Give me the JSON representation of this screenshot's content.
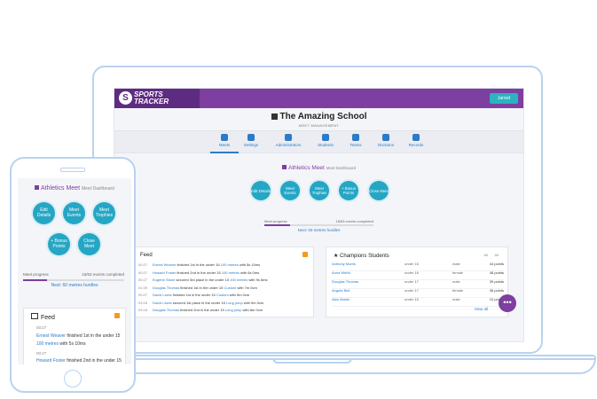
{
  "app": {
    "logo_top": "SPORTS",
    "logo_bottom": "TRACKER",
    "account_button": "Jarrod"
  },
  "school": {
    "title": "The Amazing School",
    "subtitle": "MEET MANAGEMENT"
  },
  "nav": [
    {
      "label": "Meets",
      "active": true
    },
    {
      "label": "Settings"
    },
    {
      "label": "Administrators"
    },
    {
      "label": "Students"
    },
    {
      "label": "Teams"
    },
    {
      "label": "Divisions"
    },
    {
      "label": "Records"
    }
  ],
  "meet": {
    "title": "Athletics Meet",
    "subtitle": "Meet Dashboard"
  },
  "actions": [
    "Edit Details",
    "Meet Events",
    "Meet Trophies",
    "+ Bonus Points",
    "Close Meet"
  ],
  "progress": {
    "label": "Meet progress",
    "count": "15/63 events completed",
    "fraction": 0.238,
    "next": "Next: 60 metres hurdles"
  },
  "feed": {
    "title": "Feed",
    "rows": [
      {
        "time": "00:27",
        "name": "Ernest Weaver",
        "pre": "finished 1st in the under 15",
        "event": "100 metres",
        "post": "with 5s 10ms"
      },
      {
        "time": "00:27",
        "name": "Howard Foster",
        "pre": "finished 2nd in the under 15",
        "event": "100 metres",
        "post": "with 6s 0ms"
      },
      {
        "time": "00:27",
        "name": "Eugene Stone",
        "pre": "secured 3rd place in the under 15",
        "event": "100 metres",
        "post": "with 9s 6ms"
      },
      {
        "time": "01:39",
        "name": "Douglas Thomas",
        "pre": "finished 1st in the under 15",
        "event": "Custom",
        "post": "with 7m 0cm"
      },
      {
        "time": "00:27",
        "name": "David Lewis",
        "pre": "finished 1st in the under 15",
        "event": "Custom",
        "post": "with 5m 0cm"
      },
      {
        "time": "03:18",
        "name": "David Lewis",
        "pre": "secured 1st place in the under 15",
        "event": "Long jump",
        "post": "with 9m 0cm"
      },
      {
        "time": "03:18",
        "name": "Douglas Thomas",
        "pre": "finished 2nd in the under 15",
        "event": "Long jump",
        "post": "with 8m 0cm"
      }
    ]
  },
  "champions": {
    "title": "Champions Students",
    "filter1": "All",
    "filter2": "All",
    "rows": [
      {
        "name": "Anthony Morris",
        "division": "under 16",
        "gender": "male",
        "points": "44 points"
      },
      {
        "name": "Anna Webb",
        "division": "under 16",
        "gender": "female",
        "points": "48 points"
      },
      {
        "name": "Douglas Thomas",
        "division": "under 17",
        "gender": "male",
        "points": "39 points"
      },
      {
        "name": "Angela Bell",
        "division": "under 17",
        "gender": "female",
        "points": "36 points"
      },
      {
        "name": "Alan Martin",
        "division": "under 15",
        "gender": "male",
        "points": "10 points"
      }
    ],
    "view_all": "View all"
  },
  "chat_icon": "chat-bubble",
  "mobile": {
    "meet_title": "Athletics Meet",
    "meet_sub": "Meet Dashboard",
    "actions": [
      "Edit Details",
      "Meet Events",
      "Meet Trophies",
      "+ Bonus Points",
      "Close Meet"
    ],
    "progress_label": "Meet progress",
    "progress_count": "15/63 events completed",
    "next": "Next: 60 metres hurdles",
    "feed_title": "Feed",
    "feed": [
      {
        "time": "00:27",
        "name": "Ernest Weaver",
        "pre": "finished 1st in the under 15",
        "event": "100 metres",
        "post": "with 5s 10ms"
      },
      {
        "time": "00:27",
        "name": "Howard Foster",
        "pre": "finished 2nd in the under 15",
        "event": "",
        "post": ""
      }
    ]
  }
}
